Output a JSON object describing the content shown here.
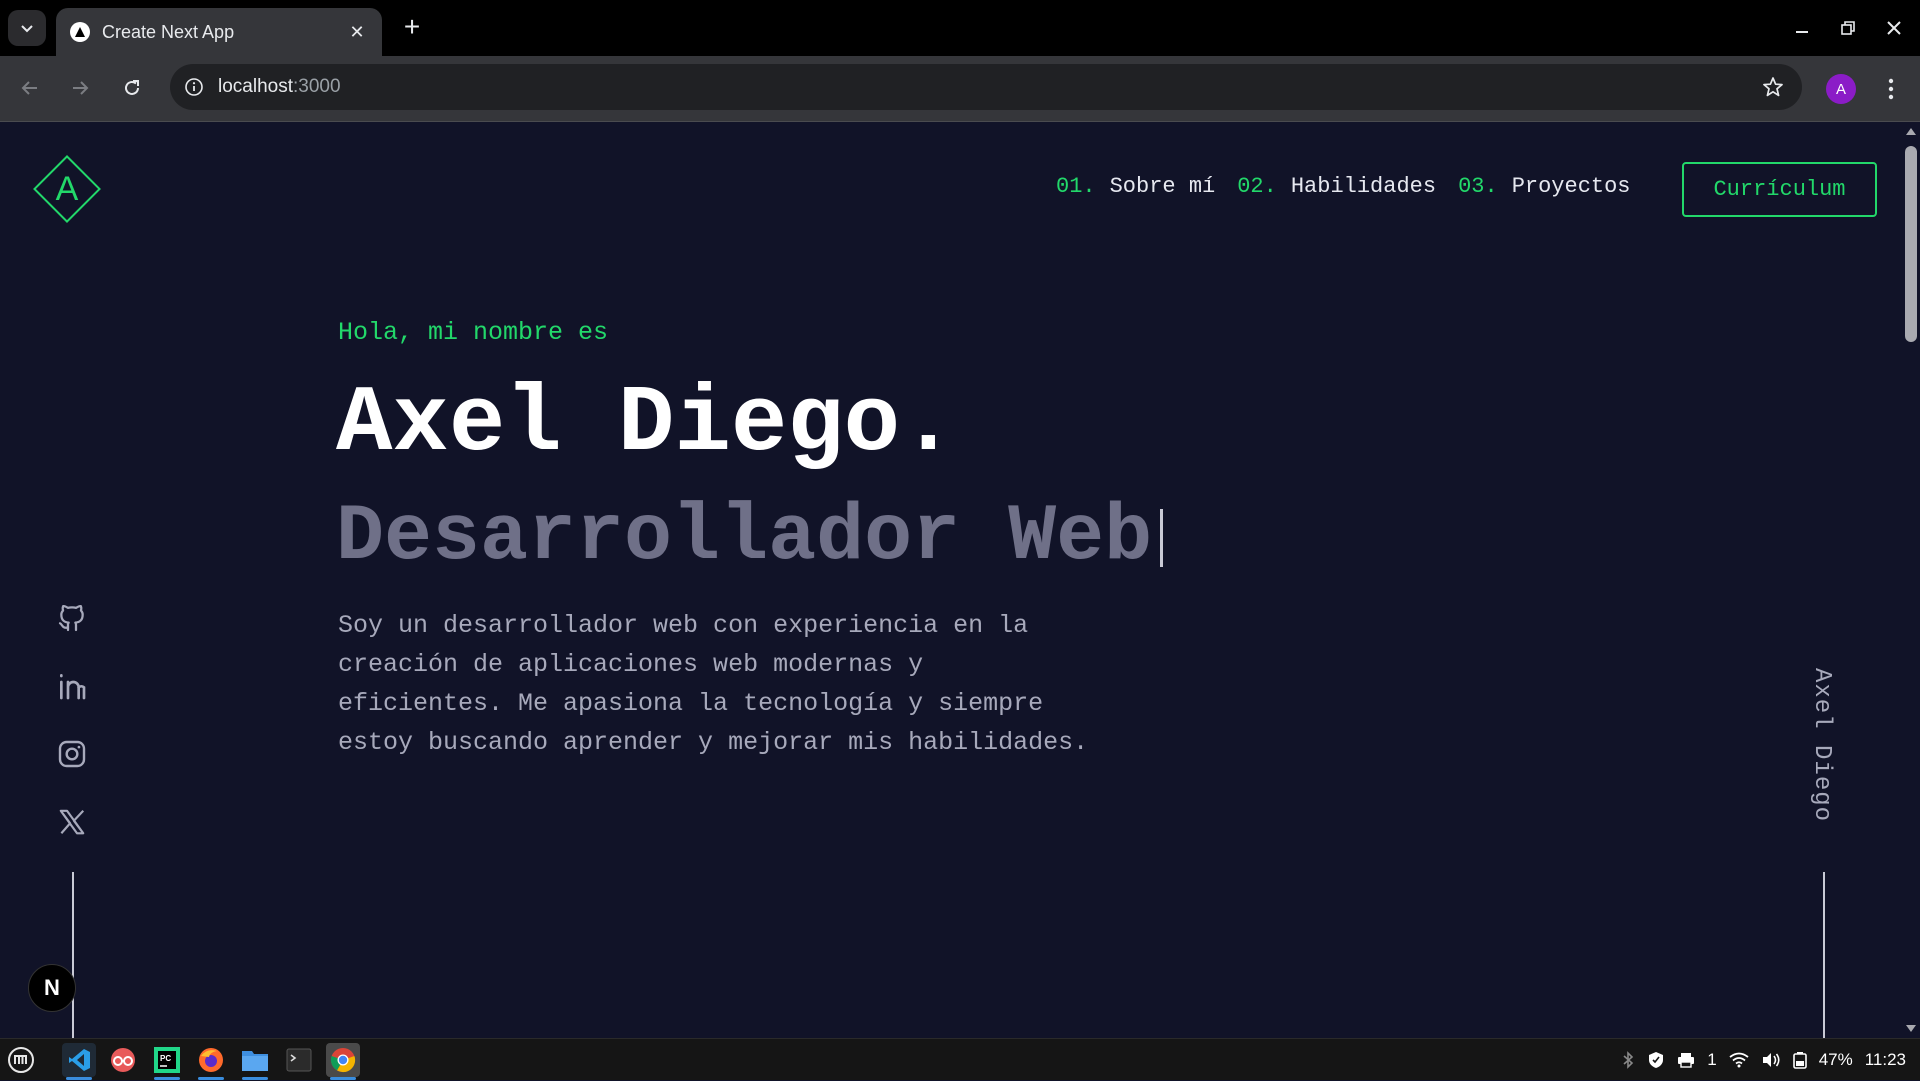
{
  "browser": {
    "tab_title": "Create Next App",
    "url_host": "localhost",
    "url_port": ":3000",
    "profile_initial": "A"
  },
  "page": {
    "logo_letter": "A",
    "nav": [
      {
        "num": "01.",
        "label": "Sobre mí"
      },
      {
        "num": "02.",
        "label": "Habilidades"
      },
      {
        "num": "03.",
        "label": "Proyectos"
      }
    ],
    "cv_button": "Currículum",
    "greeting": "Hola, mi nombre es",
    "name": "Axel Diego.",
    "role": "Desarrollador Web",
    "description": "Soy un desarrollador web con experiencia en la creación de aplicaciones web modernas y eficientes. Me apasiona la tecnología y siempre estoy buscando aprender y mejorar mis habilidades.",
    "vertical_name": "Axel Diego",
    "social_icons": [
      "github-icon",
      "linkedin-icon",
      "instagram-icon",
      "x-icon"
    ],
    "next_badge": "N",
    "accent_color": "#22d86a",
    "background_color": "#111328"
  },
  "taskbar": {
    "apps": [
      "menu-icon",
      "vscode-icon",
      "glasses-app-icon",
      "pycharm-icon",
      "firefox-icon",
      "files-icon",
      "terminal-icon",
      "chrome-icon"
    ],
    "print_count": "1",
    "battery": "47%",
    "clock": "11:23"
  }
}
